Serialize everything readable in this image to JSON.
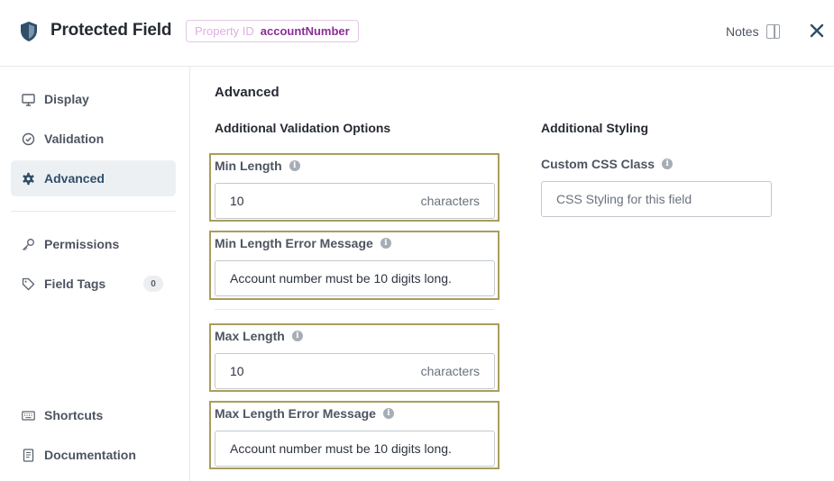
{
  "header": {
    "title": "Protected Field",
    "property_id_label": "Property ID",
    "property_id_value": "accountNumber",
    "notes_label": "Notes"
  },
  "sidebar": {
    "items": [
      {
        "label": "Display",
        "icon": "monitor-icon"
      },
      {
        "label": "Validation",
        "icon": "check-circle-icon"
      },
      {
        "label": "Advanced",
        "icon": "gear-icon",
        "active": true
      },
      {
        "label": "Permissions",
        "icon": "key-icon"
      },
      {
        "label": "Field Tags",
        "icon": "tag-icon",
        "count": "0"
      },
      {
        "label": "Shortcuts",
        "icon": "keyboard-icon"
      },
      {
        "label": "Documentation",
        "icon": "document-icon"
      }
    ]
  },
  "main": {
    "title": "Advanced",
    "validation": {
      "title": "Additional Validation Options",
      "min_length": {
        "label": "Min Length",
        "value": "10",
        "suffix": "characters"
      },
      "min_length_error": {
        "label": "Min Length Error Message",
        "value": "Account number must be 10 digits long."
      },
      "max_length": {
        "label": "Max Length",
        "value": "10",
        "suffix": "characters"
      },
      "max_length_error": {
        "label": "Max Length Error Message",
        "value": "Account number must be 10 digits long."
      }
    },
    "styling": {
      "title": "Additional Styling",
      "custom_css": {
        "label": "Custom CSS Class",
        "placeholder": "CSS Styling for this field"
      }
    }
  },
  "colors": {
    "accent": "#2f4f6b",
    "highlight_border": "#a99e5b",
    "property_id_value": "#8c2e96"
  }
}
